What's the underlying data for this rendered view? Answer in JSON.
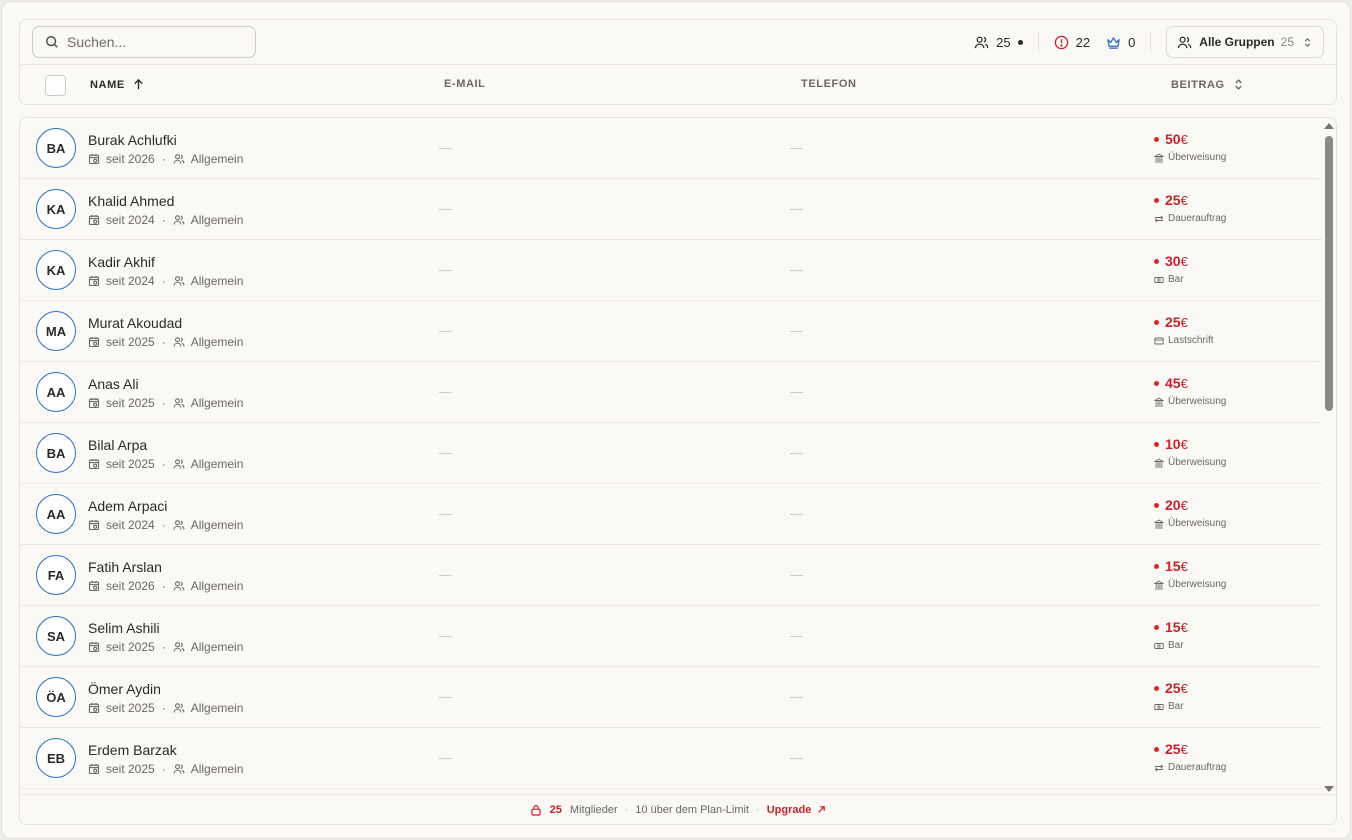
{
  "search": {
    "placeholder": "Suchen..."
  },
  "stats": {
    "members": "25",
    "warnings": "22",
    "admins": "0"
  },
  "group_filter": {
    "label": "Alle Gruppen",
    "count": "25"
  },
  "columns": {
    "name": "NAME",
    "email": "E-MAIL",
    "phone": "TELEFON",
    "fee": "BEITRAG"
  },
  "members": [
    {
      "initials": "BA",
      "name": "Burak Achlufki",
      "since": "seit 2026",
      "group": "Allgemein",
      "email": "—",
      "phone": "—",
      "amount": "50",
      "currency": "€",
      "payment": "Überweisung",
      "payment_icon": "bank-icon"
    },
    {
      "initials": "KA",
      "name": "Khalid Ahmed",
      "since": "seit 2024",
      "group": "Allgemein",
      "email": "—",
      "phone": "—",
      "amount": "25",
      "currency": "€",
      "payment": "Dauerauftrag",
      "payment_icon": "repeat-icon"
    },
    {
      "initials": "KA",
      "name": "Kadir Akhif",
      "since": "seit 2024",
      "group": "Allgemein",
      "email": "—",
      "phone": "—",
      "amount": "30",
      "currency": "€",
      "payment": "Bar",
      "payment_icon": "cash-icon"
    },
    {
      "initials": "MA",
      "name": "Murat Akoudad",
      "since": "seit 2025",
      "group": "Allgemein",
      "email": "—",
      "phone": "—",
      "amount": "25",
      "currency": "€",
      "payment": "Lastschrift",
      "payment_icon": "card-icon"
    },
    {
      "initials": "AA",
      "name": "Anas Ali",
      "since": "seit 2025",
      "group": "Allgemein",
      "email": "—",
      "phone": "—",
      "amount": "45",
      "currency": "€",
      "payment": "Überweisung",
      "payment_icon": "bank-icon"
    },
    {
      "initials": "BA",
      "name": "Bilal Arpa",
      "since": "seit 2025",
      "group": "Allgemein",
      "email": "—",
      "phone": "—",
      "amount": "10",
      "currency": "€",
      "payment": "Überweisung",
      "payment_icon": "bank-icon"
    },
    {
      "initials": "AA",
      "name": "Adem Arpaci",
      "since": "seit 2024",
      "group": "Allgemein",
      "email": "—",
      "phone": "—",
      "amount": "20",
      "currency": "€",
      "payment": "Überweisung",
      "payment_icon": "bank-icon"
    },
    {
      "initials": "FA",
      "name": "Fatih Arslan",
      "since": "seit 2026",
      "group": "Allgemein",
      "email": "—",
      "phone": "—",
      "amount": "15",
      "currency": "€",
      "payment": "Überweisung",
      "payment_icon": "bank-icon"
    },
    {
      "initials": "SA",
      "name": "Selim Ashili",
      "since": "seit 2025",
      "group": "Allgemein",
      "email": "—",
      "phone": "—",
      "amount": "15",
      "currency": "€",
      "payment": "Bar",
      "payment_icon": "cash-icon"
    },
    {
      "initials": "ÖA",
      "name": "Ömer Aydin",
      "since": "seit 2025",
      "group": "Allgemein",
      "email": "—",
      "phone": "—",
      "amount": "25",
      "currency": "€",
      "payment": "Bar",
      "payment_icon": "cash-icon"
    },
    {
      "initials": "EB",
      "name": "Erdem Barzak",
      "since": "seit 2025",
      "group": "Allgemein",
      "email": "—",
      "phone": "—",
      "amount": "25",
      "currency": "€",
      "payment": "Dauerauftrag",
      "payment_icon": "repeat-icon"
    }
  ],
  "footer": {
    "count": "25",
    "members_label": "Mitglieder",
    "limit_text": "10 über dem Plan-Limit",
    "upgrade_label": "Upgrade"
  },
  "colors": {
    "accent_red": "#c8232a",
    "avatar_ring": "#2f6ec2",
    "admin_icon": "#2f6ec2"
  }
}
